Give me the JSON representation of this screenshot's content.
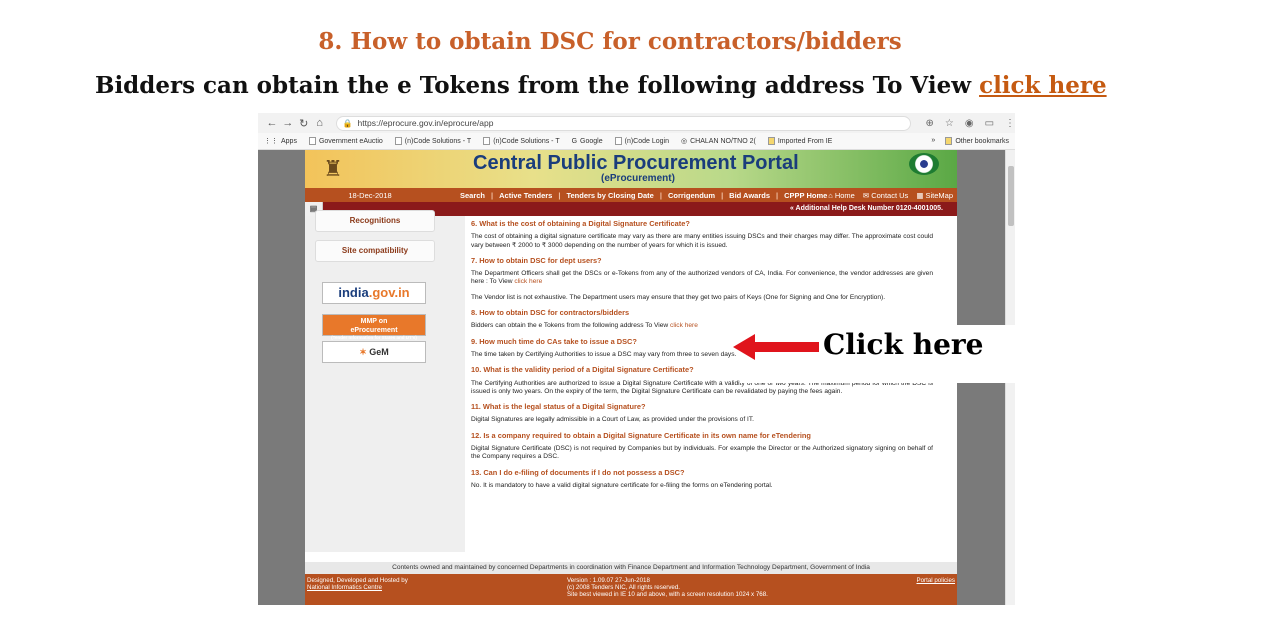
{
  "slide": {
    "heading": "8. How to obtain DSC for contractors/bidders",
    "sub_text": "Bidders can obtain the e Tokens from the following address To View",
    "sub_link": "click here",
    "callout": "Click here"
  },
  "browser": {
    "url": "https://eprocure.gov.in/eprocure/app",
    "bookmarks": [
      "Apps",
      "Government eAuctio",
      "(n)Code Solutions - T",
      "(n)Code Solutions - T",
      "Google",
      "(n)Code Login",
      "CHALAN NO/TNO 2(",
      "Imported From IE"
    ],
    "bookmarks_more": "»",
    "other_bookmarks": "Other bookmarks"
  },
  "portal": {
    "title": "Central Public Procurement Portal",
    "subtitle": "(eProcurement)",
    "date": "18-Dec-2018",
    "nav": [
      "Search",
      "Active Tenders",
      "Tenders by Closing Date",
      "Corrigendum",
      "Bid Awards",
      "CPPP Home"
    ],
    "home": "Home",
    "contact": "Contact Us",
    "sitemap": "SiteMap",
    "help": "« Additional Help Desk Number 0120-4001005.",
    "sidebar": {
      "recognitions": "Recognitions",
      "site_compat": "Site compatibility",
      "india_a": "india",
      "india_b": ".gov.in",
      "mmp_line1": "MMP on",
      "mmp_line2": "eProcurement",
      "mmp_line3": "(Tender Information for States and UT's)",
      "gem": "GeM"
    },
    "faq": [
      {
        "q": "6. What is the cost of obtaining a Digital Signature Certificate?",
        "a": "The cost of obtaining a digital signature certificate may vary as there are many entities issuing DSCs and their charges may differ. The approximate cost could vary between ₹ 2000 to ₹ 3000 depending on the number of years for which it is issued."
      },
      {
        "q": "7. How to obtain DSC for dept users?",
        "a": "The Department Officers shall get the DSCs or e-Tokens from any of the authorized vendors of CA, India. For convenience, the vendor addresses are given here : To View",
        "link": "click here",
        "a2": "The Vendor list is not exhaustive. The Department users may ensure that they get two pairs of Keys (One for Signing and One for Encryption)."
      },
      {
        "q": "8. How to obtain DSC for contractors/bidders",
        "a": "Bidders can obtain the e Tokens from the following address To View",
        "link": "click here"
      },
      {
        "q": "9. How much time do CAs take to issue a DSC?",
        "a": "The time taken by Certifying Authorities to issue a DSC may vary from three to seven days."
      },
      {
        "q": "10. What is the validity period of a Digital Signature Certificate?",
        "a": "The Certifying Authorities are authorized to issue a Digital Signature Certificate with a validity of one or two years. The maximum period for which the DSC is issued is only two years. On the expiry of the term, the Digital Signature Certificate can be revalidated by paying the fees again."
      },
      {
        "q": "11. What is the legal status of a Digital Signature?",
        "a": "Digital Signatures are legally admissible in a Court of Law, as provided under the provisions of IT."
      },
      {
        "q": "12. Is a company required to obtain a Digital Signature Certificate in its own name for eTendering",
        "a": "Digital Signature Certificate (DSC) is not required by Companies but by individuals. For example the Director or the Authorized signatory signing on behalf of the Company requires a DSC."
      },
      {
        "q": "13. Can I do e-filing of documents if I do not possess a DSC?",
        "a": "No. It is mandatory to have a valid digital signature certificate for e-filing the forms on eTendering portal."
      }
    ],
    "footer_info": "Contents owned and maintained by concerned Departments in coordination with Finance Department and Information Technology Department, Government of India",
    "footer_left1": "Designed, Developed and Hosted by",
    "footer_left2": "National Informatics Centre",
    "footer_mid1": "Version : 1.09.07 27-Jun-2018",
    "footer_mid2": "(c) 2008 Tenders NIC, All rights reserved.",
    "footer_mid3": "Site best viewed in IE 10 and above, with a screen resolution 1024 x 768.",
    "footer_right": "Portal policies"
  },
  "colors": {
    "accent": "#b6501f",
    "heading": "#c8602a",
    "help_bar": "#8b1a1a",
    "arrow": "#e0141c"
  }
}
